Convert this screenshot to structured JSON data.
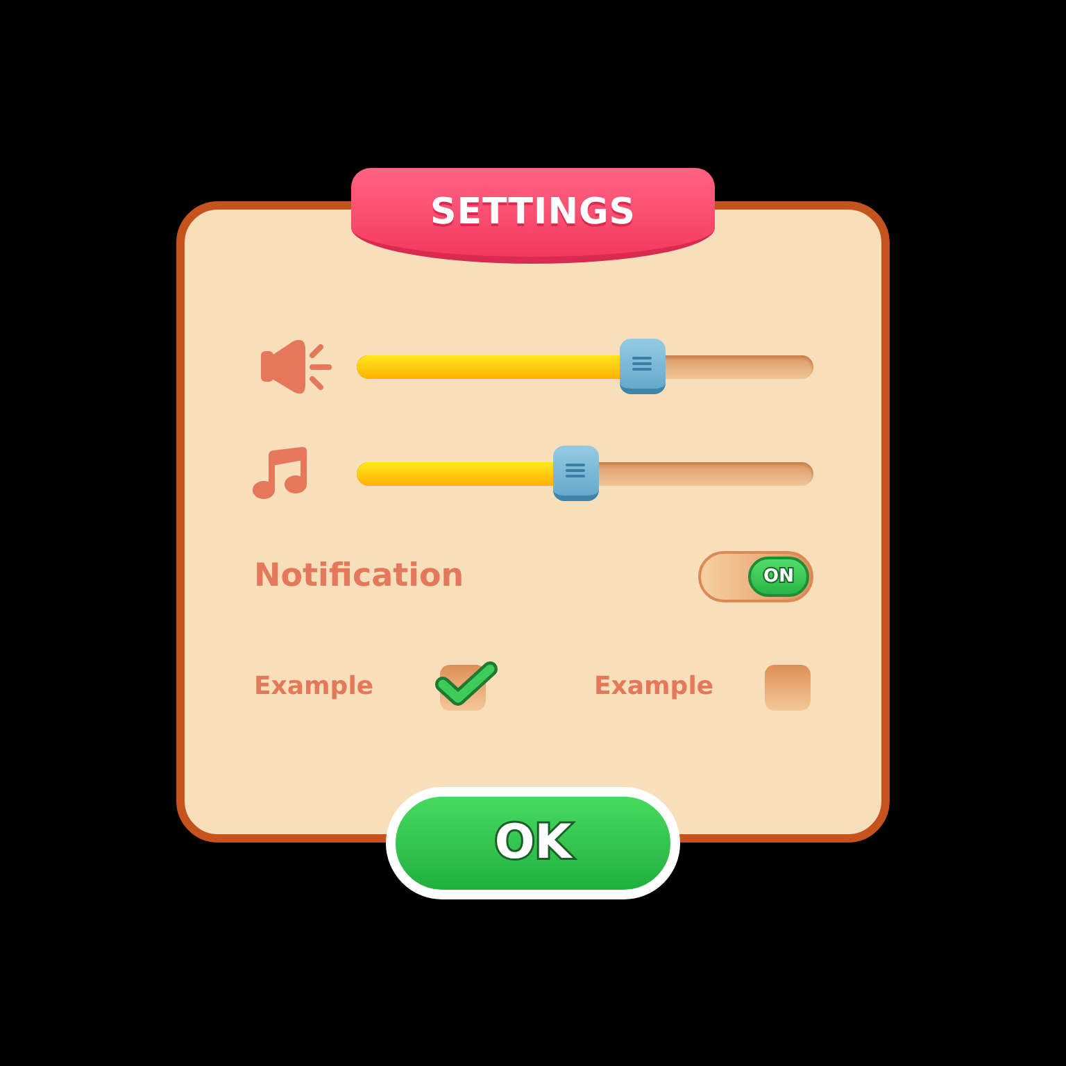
{
  "title": "SETTINGS",
  "sliders": [
    {
      "kind": "volume",
      "level": 0.625
    },
    {
      "kind": "music",
      "level": 0.48
    }
  ],
  "notification": {
    "label": "Notification",
    "on": true,
    "state_label": "ON"
  },
  "checkboxes": [
    {
      "label": "Example",
      "checked": true
    },
    {
      "label": "Example",
      "checked": false
    }
  ],
  "ok_button": {
    "label": "OK"
  }
}
